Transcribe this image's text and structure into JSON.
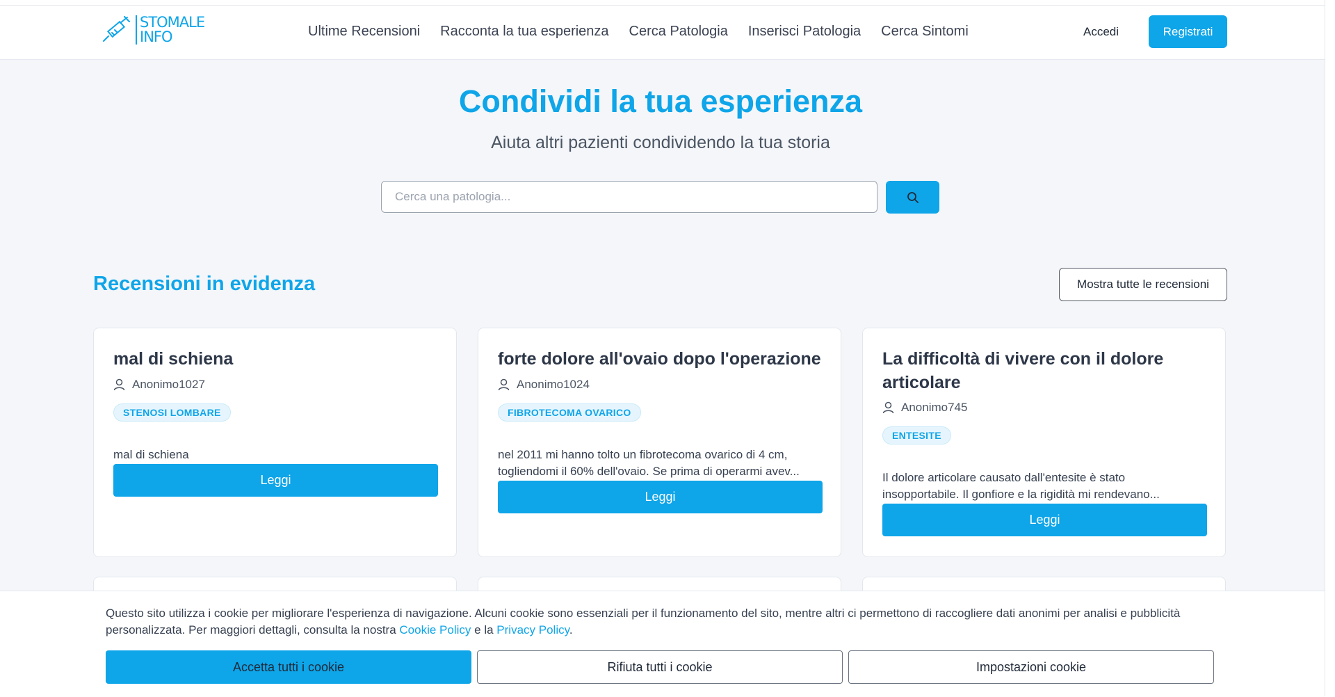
{
  "brand": {
    "logo_line1": "STOMALE",
    "logo_line2": "INFO",
    "accent": "#0ea5e9"
  },
  "nav": {
    "items": [
      {
        "label": "Ultime Recensioni"
      },
      {
        "label": "Racconta la tua esperienza"
      },
      {
        "label": "Cerca Patologia"
      },
      {
        "label": "Inserisci Patologia"
      },
      {
        "label": "Cerca Sintomi"
      }
    ],
    "login": "Accedi",
    "register": "Registrati"
  },
  "hero": {
    "title": "Condividi la tua esperienza",
    "subtitle": "Aiuta altri pazienti condividendo la tua storia",
    "search_placeholder": "Cerca una patologia...",
    "search_icon": "search-icon"
  },
  "featured": {
    "title": "Recensioni in evidenza",
    "show_all": "Mostra tutte le recensioni",
    "cards": [
      {
        "title": "mal di schiena",
        "author": "Anonimo1027",
        "tag": "STENOSI LOMBARE",
        "excerpt_line1": "mal di schiena",
        "excerpt_line2": "",
        "button": "Leggi"
      },
      {
        "title": "forte dolore all'ovaio dopo l'operazione",
        "author": "Anonimo1024",
        "tag": "FIBROTECOMA OVARICO",
        "excerpt_line1": "nel 2011 mi hanno tolto un fibrotecoma ovarico di 4 cm,",
        "excerpt_line2": "togliendomi il 60% dell'ovaio. Se prima di operarmi avev...",
        "button": "Leggi"
      },
      {
        "title": "La difficoltà di vivere con il dolore articolare",
        "author": "Anonimo745",
        "tag": "ENTESITE",
        "excerpt_line1": "Il dolore articolare causato dall'entesite è stato",
        "excerpt_line2": "insopportabile. Il gonfiore e la rigidità mi rendevano...",
        "button": "Leggi"
      }
    ]
  },
  "cookie": {
    "text": "Questo sito utilizza i cookie per migliorare l'esperienza di navigazione. Alcuni cookie sono essenziali per il funzionamento del sito, mentre altri ci permettono di raccogliere dati anonimi per analisi e pubblicità personalizzata. Per maggiori dettagli, consulta la nostra",
    "cookie_policy": "Cookie Policy",
    "and": "e la",
    "privacy_policy": "Privacy Policy",
    "period": ".",
    "accept": "Accetta tutti i cookie",
    "reject": "Rifiuta tutti i cookie",
    "settings": "Impostazioni cookie"
  }
}
